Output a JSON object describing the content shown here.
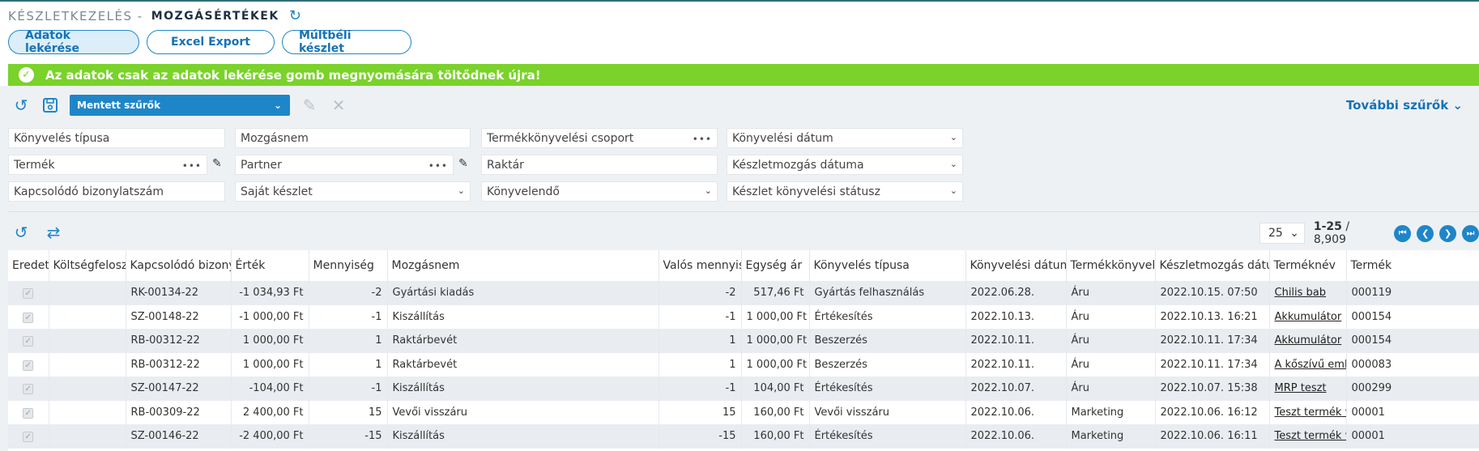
{
  "header": {
    "crumb": "KÉSZLETKEZELÉS -",
    "title": "MOZGÁSÉRTÉKEK"
  },
  "buttons": {
    "fetch": "Adatok lekérése",
    "excel": "Excel Export",
    "past": "Múltbéli készlet"
  },
  "banner": {
    "text": "Az adatok csak az adatok lekérése gomb megnyomására töltődnek újra!"
  },
  "filters": {
    "saved": "Mentett szűrők",
    "more": "További szűrők",
    "booking_type": "Könyvelés típusa",
    "movement": "Mozgásnem",
    "product_group": "Termékkönyvelési csoport",
    "booking_date": "Könyvelési dátum",
    "product": "Termék",
    "partner": "Partner",
    "warehouse": "Raktár",
    "movement_date": "Készletmozgás dátuma",
    "related_doc": "Kapcsolódó bizonylatszám",
    "own_stock": "Saját készlet",
    "to_book": "Könyvelendő",
    "stock_status": "Készlet könyvelési státusz"
  },
  "pager": {
    "size": "25",
    "range": "1-25",
    "total": "/ 8,909"
  },
  "columns": [
    "Eredet",
    "Költségfeloszt",
    "Kapcsolódó bizonylat",
    "Érték",
    "Mennyiség",
    "Mozgásnem",
    "Valós mennyiség",
    "Egység ár",
    "Könyvelés típusa",
    "Könyvelési dátum",
    "Termékkönyvelési",
    "Készletmozgás dátum",
    "Terméknév",
    "Termék"
  ],
  "rows": [
    {
      "doc": "RK-00134-22",
      "value": "-1 034,93 Ft",
      "qty": "-2",
      "move": "Gyártási kiadás",
      "real": "-2",
      "unit": "517,46 Ft",
      "btype": "Gyártás felhasználás",
      "bdate": "2022.06.28.",
      "group": "Áru",
      "mdate": "2022.10.15. 07:50",
      "name": "Chilis bab",
      "code": "000119"
    },
    {
      "doc": "SZ-00148-22",
      "value": "-1 000,00 Ft",
      "qty": "-1",
      "move": "Kiszállítás",
      "real": "-1",
      "unit": "1 000,00 Ft",
      "btype": "Értékesítés",
      "bdate": "2022.10.13.",
      "group": "Áru",
      "mdate": "2022.10.13. 16:21",
      "name": "Akkumulátor",
      "code": "000154"
    },
    {
      "doc": "RB-00312-22",
      "value": "1 000,00 Ft",
      "qty": "1",
      "move": "Raktárbevét",
      "real": "1",
      "unit": "1 000,00 Ft",
      "btype": "Beszerzés",
      "bdate": "2022.10.11.",
      "group": "Áru",
      "mdate": "2022.10.11. 17:34",
      "name": "Akkumulátor",
      "code": "000154"
    },
    {
      "doc": "RB-00312-22",
      "value": "1 000,00 Ft",
      "qty": "1",
      "move": "Raktárbevét",
      "real": "1",
      "unit": "1 000,00 Ft",
      "btype": "Beszerzés",
      "bdate": "2022.10.11.",
      "group": "Áru",
      "mdate": "2022.10.11. 17:34",
      "name": "A kőszívű emb",
      "code": "000083"
    },
    {
      "doc": "SZ-00147-22",
      "value": "-104,00 Ft",
      "qty": "-1",
      "move": "Kiszállítás",
      "real": "-1",
      "unit": "104,00 Ft",
      "btype": "Értékesítés",
      "bdate": "2022.10.07.",
      "group": "Áru",
      "mdate": "2022.10.07. 15:38",
      "name": "MRP teszt",
      "code": "000299"
    },
    {
      "doc": "RB-00309-22",
      "value": "2 400,00 Ft",
      "qty": "15",
      "move": "Vevői visszáru",
      "real": "15",
      "unit": "160,00 Ft",
      "btype": "Vevői visszáru",
      "bdate": "2022.10.06.",
      "group": "Marketing",
      "mdate": "2022.10.06. 16:12",
      "name": "Teszt termék v",
      "code": "00001"
    },
    {
      "doc": "SZ-00146-22",
      "value": "-2 400,00 Ft",
      "qty": "-15",
      "move": "Kiszállítás",
      "real": "-15",
      "unit": "160,00 Ft",
      "btype": "Értékesítés",
      "bdate": "2022.10.06.",
      "group": "Marketing",
      "mdate": "2022.10.06. 16:11",
      "name": "Teszt termék v",
      "code": "00001"
    }
  ]
}
